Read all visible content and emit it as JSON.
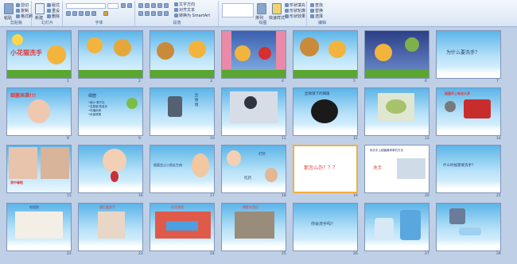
{
  "ribbon": {
    "clipboard_label": "剪贴板",
    "paste_label": "粘贴",
    "cut_label": "剪切",
    "copy_label": "复制",
    "format_painter_label": "格式刷",
    "slides_label": "幻灯片",
    "new_slide_label": "新建",
    "layout_label": "版式",
    "reset_label": "重设",
    "delete_label": "删除",
    "font_label": "字体",
    "paragraph_label": "段落",
    "text_direction_label": "文字方向",
    "align_text_label": "对齐文本",
    "smartart_label": "转换为 SmartArt",
    "drawing_label": "绘图",
    "arrange_label": "排列",
    "quick_styles_label": "快速样式",
    "shape_fill_label": "形状填充",
    "shape_outline_label": "形状轮廓",
    "shape_effects_label": "形状效果",
    "editing_label": "编辑",
    "find_label": "查找",
    "replace_label": "替换",
    "select_label": "选择"
  },
  "slides": [
    {
      "n": "1",
      "title": "小花猫洗手"
    },
    {
      "n": "2",
      "title": ""
    },
    {
      "n": "3",
      "title": ""
    },
    {
      "n": "4",
      "title": ""
    },
    {
      "n": "5",
      "title": ""
    },
    {
      "n": "6",
      "title": ""
    },
    {
      "n": "7",
      "title": "为什么要洗手？"
    },
    {
      "n": "8",
      "title": "细菌来袭!!!"
    },
    {
      "n": "9",
      "title": "细菌",
      "bullets": [
        "•细小  看不见",
        "•会繁殖  数量多",
        "•传播疾病",
        "•危害健康"
      ]
    },
    {
      "n": "10",
      "title": "显 微 镜"
    },
    {
      "n": "11",
      "title": ""
    },
    {
      "n": "12",
      "title": "显微镜下的细菌"
    },
    {
      "n": "13",
      "title": ""
    },
    {
      "n": "14",
      "title": "细菌手上有这么多"
    },
    {
      "n": "15",
      "title": "我中毒啦"
    },
    {
      "n": "16",
      "title": ""
    },
    {
      "n": "17",
      "title": "细菌会让小朋友生病"
    },
    {
      "n": "18",
      "title": "打针",
      "sub": "吃药"
    },
    {
      "n": "19",
      "title": "那怎么办？？？"
    },
    {
      "n": "20",
      "title": "除去手上细菌最简单的方法",
      "sub": "洗手"
    },
    {
      "n": "21",
      "title": "什么时候需要洗手？"
    },
    {
      "n": "22",
      "title": "吃饭前"
    },
    {
      "n": "23",
      "title": "便后要洗手"
    },
    {
      "n": "24",
      "title": "玩完游戏"
    },
    {
      "n": "25",
      "title": "摸脏东西后"
    },
    {
      "n": "26",
      "title": "你会洗手吗？"
    },
    {
      "n": "27",
      "title": ""
    },
    {
      "n": "28",
      "title": ""
    }
  ]
}
